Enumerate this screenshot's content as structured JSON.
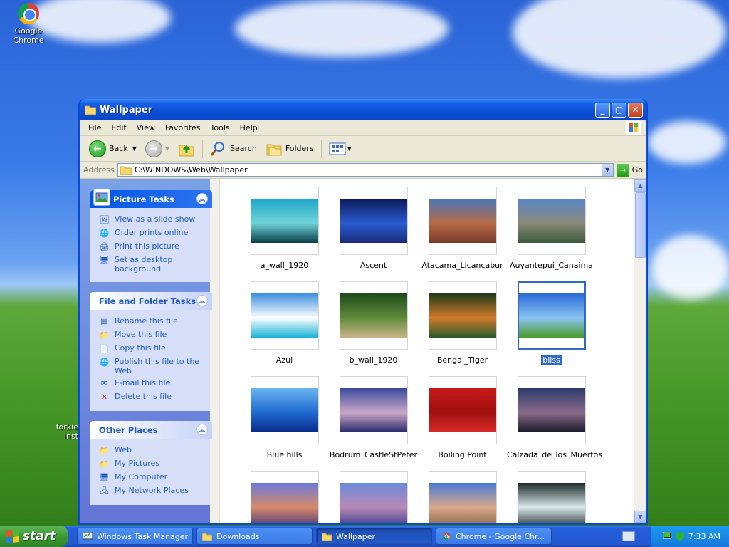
{
  "desktop": {
    "icons": [
      {
        "label": "Google Chrome"
      },
      {
        "label": "forkie\ninst"
      }
    ]
  },
  "window": {
    "title": "Wallpaper",
    "menu": [
      "File",
      "Edit",
      "View",
      "Favorites",
      "Tools",
      "Help"
    ],
    "toolbar": {
      "back_label": "Back",
      "search_label": "Search",
      "folders_label": "Folders"
    },
    "address": {
      "label": "Address",
      "value": "C:\\WINDOWS\\Web\\Wallpaper",
      "go_label": "Go"
    }
  },
  "taskpane": {
    "picture_tasks": {
      "title": "Picture Tasks",
      "items": [
        "View as a slide show",
        "Order prints online",
        "Print this picture",
        "Set as desktop background"
      ]
    },
    "file_folder_tasks": {
      "title": "File and Folder Tasks",
      "items": [
        "Rename this file",
        "Move this file",
        "Copy this file",
        "Publish this file to the Web",
        "E-mail this file",
        "Delete this file"
      ]
    },
    "other_places": {
      "title": "Other Places",
      "items": [
        "Web",
        "My Pictures",
        "My Computer",
        "My Network Places"
      ]
    }
  },
  "files": [
    {
      "name": "a_wall_1920",
      "colors": [
        "#1fa6c9",
        "#6fd4d8",
        "#0b3e4a"
      ]
    },
    {
      "name": "Ascent",
      "colors": [
        "#0b1a5a",
        "#2a5bd0",
        "#1a2c7a"
      ]
    },
    {
      "name": "Atacama_Licancabur",
      "colors": [
        "#4a78b8",
        "#b56a47",
        "#7a3a2a"
      ]
    },
    {
      "name": "Auyantepui_Canaima",
      "colors": [
        "#5a86c8",
        "#8a8a7a",
        "#3a5a3a"
      ]
    },
    {
      "name": "Azul",
      "colors": [
        "#3c8fe0",
        "#ffffff",
        "#1ab3d6"
      ]
    },
    {
      "name": "b_wall_1920",
      "colors": [
        "#1f4a1a",
        "#5e8a3a",
        "#c9b48a"
      ]
    },
    {
      "name": "Bengal_Tiger",
      "colors": [
        "#1d3a1a",
        "#d27a2a",
        "#2a5a2a"
      ]
    },
    {
      "name": "bliss",
      "colors": [
        "#2a6ad8",
        "#8ac4f2",
        "#4a9a2a"
      ]
    },
    {
      "name": "Blue hills",
      "colors": [
        "#6ab4f2",
        "#1f6ad0",
        "#0a2a8a"
      ]
    },
    {
      "name": "Bodrum_CastleStPeter",
      "colors": [
        "#3a4a9a",
        "#c9a8c8",
        "#2a2a6a"
      ]
    },
    {
      "name": "Boiling Point",
      "colors": [
        "#c81a1a",
        "#a01010",
        "#d82a2a"
      ]
    },
    {
      "name": "Calzada_de_los_Muertos",
      "colors": [
        "#2a3a6a",
        "#8a6a8a",
        "#1a1a2a"
      ]
    },
    {
      "name": "",
      "colors": [
        "#6a7ad8",
        "#d88a6a",
        "#4a3a7a"
      ]
    },
    {
      "name": "",
      "colors": [
        "#6a8ad8",
        "#b88ab8",
        "#3a3a8a"
      ]
    },
    {
      "name": "",
      "colors": [
        "#4a7ad8",
        "#d8a88a",
        "#8a6a4a"
      ]
    },
    {
      "name": "",
      "colors": [
        "#1a2a2a",
        "#d8e8e8",
        "#2a3a3a"
      ]
    }
  ],
  "taskbar": {
    "start_label": "start",
    "buttons": [
      {
        "label": "Windows Task Manager",
        "active": false
      },
      {
        "label": "Downloads",
        "active": false
      },
      {
        "label": "Wallpaper",
        "active": true
      },
      {
        "label": "Chrome - Google Chr...",
        "active": false
      }
    ],
    "clock": "7:33 AM"
  }
}
